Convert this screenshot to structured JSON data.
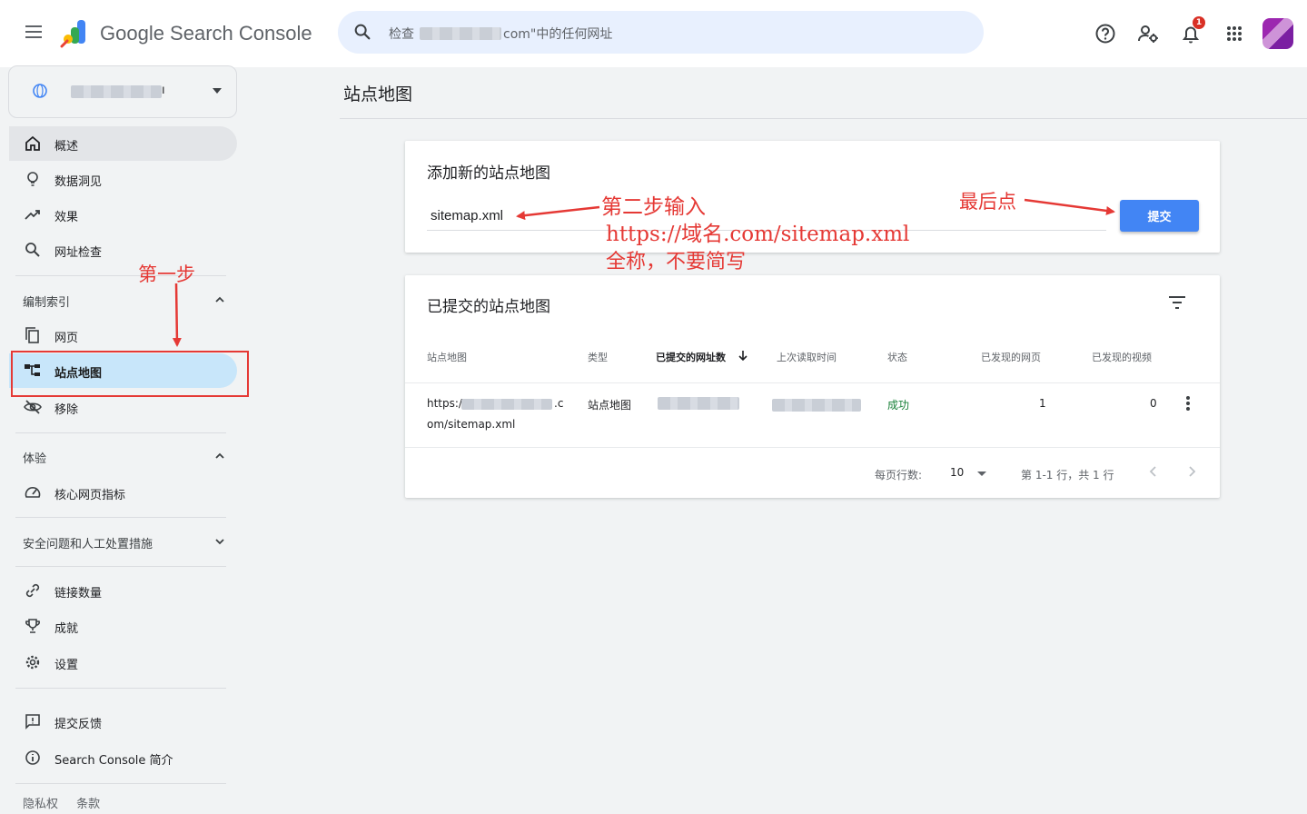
{
  "header": {
    "brand": "Google Search Console",
    "search_prefix": "检查",
    "search_suffix": "com\"中的任何网址",
    "notification_count": "1"
  },
  "sidebar": {
    "property_name_tail": "ı",
    "items_top": [
      {
        "label": "概述",
        "icon": "home-icon"
      },
      {
        "label": "数据洞见",
        "icon": "lightbulb-icon"
      },
      {
        "label": "效果",
        "icon": "trending-up-icon"
      },
      {
        "label": "网址检查",
        "icon": "search-icon"
      }
    ],
    "section_indexing": "编制索引",
    "items_indexing": [
      {
        "label": "网页",
        "icon": "copy-pages-icon"
      },
      {
        "label": "站点地图",
        "icon": "sitemap-icon"
      },
      {
        "label": "移除",
        "icon": "eye-off-icon"
      }
    ],
    "section_experience": "体验",
    "items_experience": [
      {
        "label": "核心网页指标",
        "icon": "speed-icon"
      }
    ],
    "section_security": "安全问题和人工处置措施",
    "items_bottom": [
      {
        "label": "链接数量",
        "icon": "link-icon"
      },
      {
        "label": "成就",
        "icon": "trophy-icon"
      },
      {
        "label": "设置",
        "icon": "gear-icon"
      }
    ],
    "items_help": [
      {
        "label": "提交反馈",
        "icon": "feedback-icon"
      },
      {
        "label": "Search Console 简介",
        "icon": "info-icon"
      }
    ],
    "footer": {
      "privacy": "隐私权",
      "terms": "条款"
    }
  },
  "main": {
    "page_title": "站点地图",
    "add_card": {
      "title": "添加新的站点地图",
      "input_value": "sitemap.xml",
      "submit_label": "提交"
    },
    "list_card": {
      "title": "已提交的站点地图",
      "columns": [
        "站点地图",
        "类型",
        "已提交的网址数",
        "上次读取时间",
        "状态",
        "已发现的网页",
        "已发现的视频"
      ],
      "rows": [
        {
          "sitemap_line1_prefix": "https:/",
          "sitemap_line1_suffix": ".c",
          "sitemap_line2": "om/sitemap.xml",
          "type": "站点地图",
          "status": "成功",
          "pages": "1",
          "videos": "0"
        }
      ],
      "pager": {
        "rows_per_page_label": "每页行数:",
        "rows_per_page_value": "10",
        "range_text": "第 1-1 行，共 1 行"
      }
    }
  },
  "annotations": {
    "step1": "第一步",
    "step2": "第二步输入",
    "step2_url": "https://域名.com/sitemap.xml",
    "step2_note": "全称，不要简写",
    "final": "最后点",
    "color": "#e53935"
  },
  "colors": {
    "accent": "#4285f4",
    "active_nav": "#c8e6fa",
    "success": "#188038"
  }
}
